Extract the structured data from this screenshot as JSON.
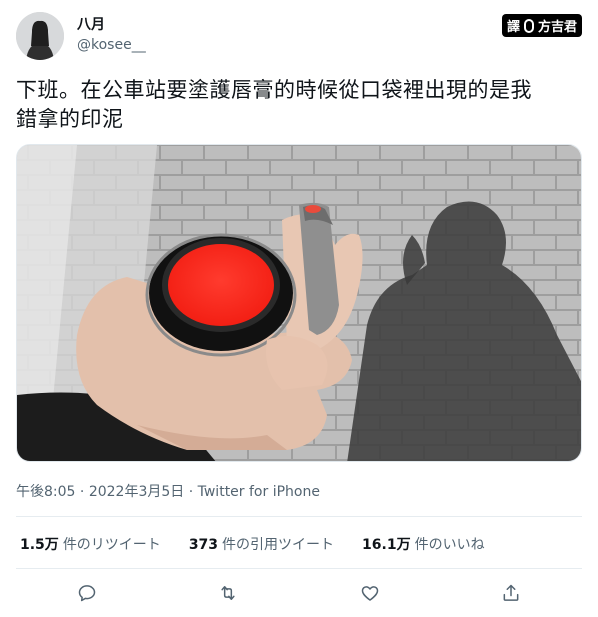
{
  "user": {
    "name": "八月",
    "handle": "@kosee__"
  },
  "badge": {
    "left": "譯",
    "right": "方吉君"
  },
  "tweet": {
    "line1": "下班。在公車站要塗護唇膏的時候從口袋裡出現的是我",
    "line2": "錯拿的印泥"
  },
  "meta": {
    "time": "午後8:05",
    "sep": "·",
    "date": "2022年3月5日",
    "source": "Twitter for iPhone"
  },
  "stats": [
    {
      "value": "1.5万",
      "label": "件のリツイート"
    },
    {
      "value": "373",
      "label": "件の引用ツイート"
    },
    {
      "value": "16.1万",
      "label": "件のいいね"
    }
  ],
  "actions": [
    {
      "icon": "reply-icon"
    },
    {
      "icon": "retweet-icon"
    },
    {
      "icon": "like-icon"
    },
    {
      "icon": "share-icon"
    }
  ],
  "colors": {
    "text": "#0f1419",
    "secondary": "#536471",
    "ink_pad_red": "#ff2a1f"
  }
}
